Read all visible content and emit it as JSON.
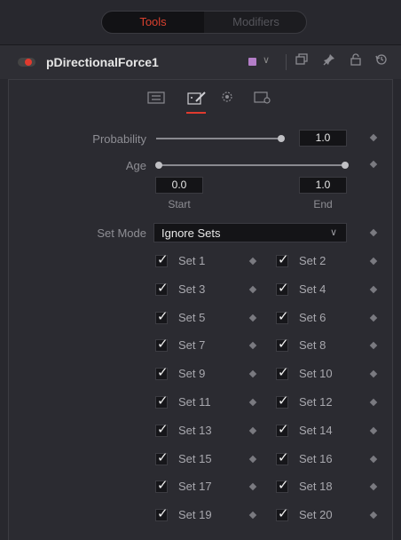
{
  "tabs": {
    "tools": "Tools",
    "modifiers": "Modifiers"
  },
  "header": {
    "tool_name": "pDirectionalForce1",
    "color_swatch": "#b47ec8"
  },
  "probability": {
    "label": "Probability",
    "value": "1.0",
    "slider_fraction": 1.0
  },
  "age": {
    "label": "Age",
    "start_value": "0.0",
    "end_value": "1.0",
    "start_label": "Start",
    "end_label": "End"
  },
  "set_mode": {
    "label": "Set Mode",
    "value": "Ignore Sets"
  },
  "sets": [
    {
      "label": "Set 1",
      "checked": true
    },
    {
      "label": "Set 2",
      "checked": true
    },
    {
      "label": "Set 3",
      "checked": true
    },
    {
      "label": "Set 4",
      "checked": true
    },
    {
      "label": "Set 5",
      "checked": true
    },
    {
      "label": "Set 6",
      "checked": true
    },
    {
      "label": "Set 7",
      "checked": true
    },
    {
      "label": "Set 8",
      "checked": true
    },
    {
      "label": "Set 9",
      "checked": true
    },
    {
      "label": "Set 10",
      "checked": true
    },
    {
      "label": "Set 11",
      "checked": true
    },
    {
      "label": "Set 12",
      "checked": true
    },
    {
      "label": "Set 13",
      "checked": true
    },
    {
      "label": "Set 14",
      "checked": true
    },
    {
      "label": "Set 15",
      "checked": true
    },
    {
      "label": "Set 16",
      "checked": true
    },
    {
      "label": "Set 17",
      "checked": true
    },
    {
      "label": "Set 18",
      "checked": true
    },
    {
      "label": "Set 19",
      "checked": true
    },
    {
      "label": "Set 20",
      "checked": true
    }
  ],
  "colors": {
    "accent": "#e03a2e",
    "background": "#28282e"
  }
}
